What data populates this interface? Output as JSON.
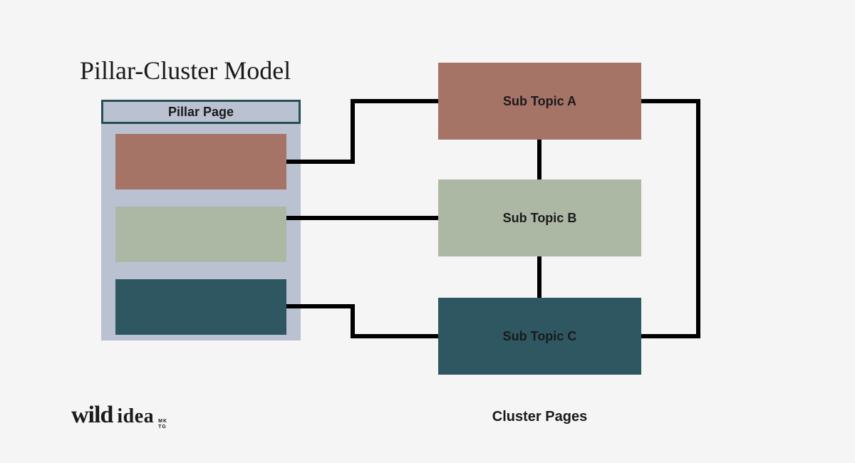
{
  "title": "Pillar-Cluster Model",
  "pillar": {
    "header": "Pillar Page"
  },
  "subtopics": {
    "a": "Sub Topic A",
    "b": "Sub Topic B",
    "c": "Sub Topic C"
  },
  "cluster_label": "Cluster Pages",
  "logo": {
    "wild": "wild",
    "idea": "idea",
    "tag1": "MK",
    "tag2": "TG"
  },
  "colors": {
    "bg": "#f5f5f5",
    "pillar_bg": "#bac2d1",
    "border": "#274e55",
    "a": "#a67367",
    "b": "#acb7a4",
    "c": "#2e5761"
  }
}
